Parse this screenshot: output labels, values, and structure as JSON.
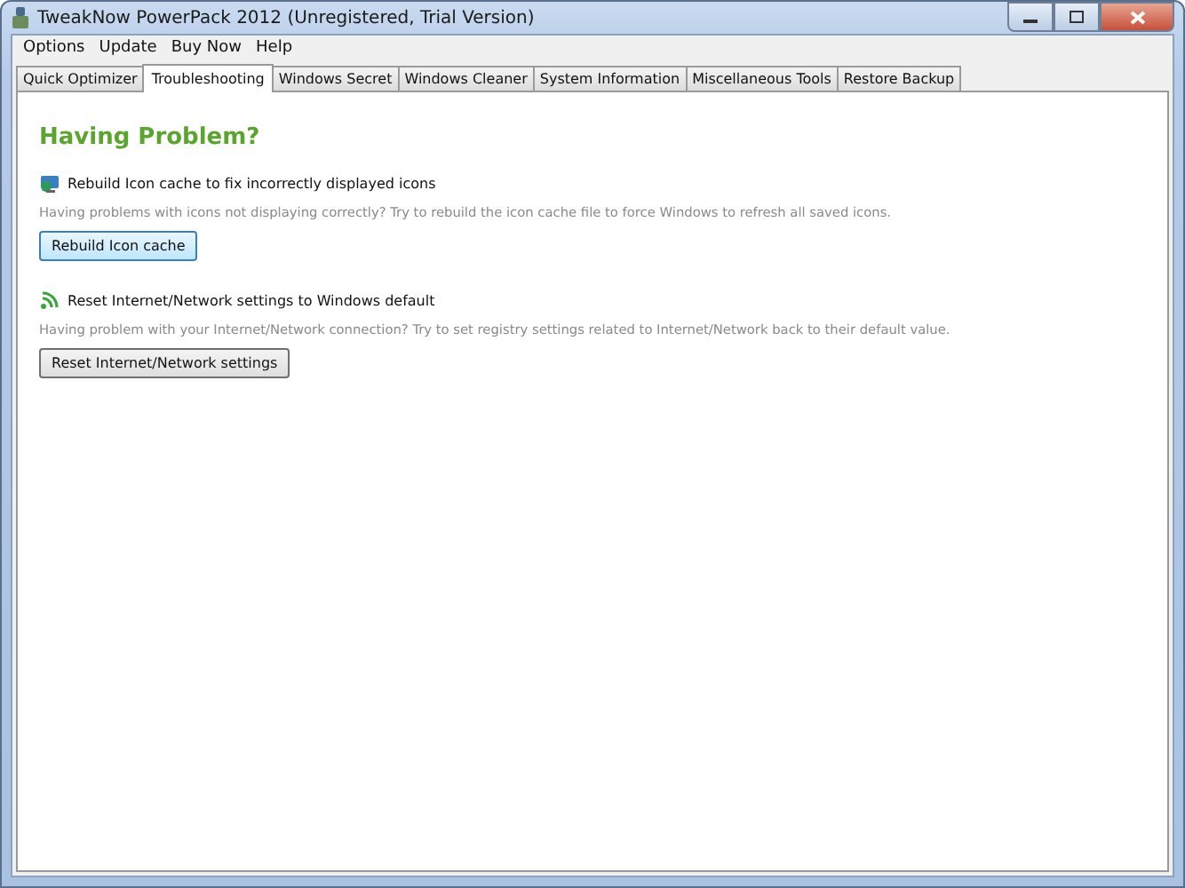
{
  "window": {
    "title": "TweakNow PowerPack 2012 (Unregistered, Trial Version)"
  },
  "menu": [
    "Options",
    "Update",
    "Buy Now",
    "Help"
  ],
  "tabs": [
    {
      "label": "Quick Optimizer",
      "selected": false
    },
    {
      "label": "Troubleshooting",
      "selected": true
    },
    {
      "label": "Windows Secret",
      "selected": false
    },
    {
      "label": "Windows Cleaner",
      "selected": false
    },
    {
      "label": "System Information",
      "selected": false
    },
    {
      "label": "Miscellaneous Tools",
      "selected": false
    },
    {
      "label": "Restore Backup",
      "selected": false
    }
  ],
  "heading": "Having Problem?",
  "sections": [
    {
      "kind": "icons",
      "title": "Rebuild Icon cache to fix incorrectly displayed icons",
      "description": "Having problems with icons not displaying correctly? Try to rebuild the icon cache file to force Windows to refresh all saved icons.",
      "button": "Rebuild Icon cache",
      "focused": true
    },
    {
      "kind": "network",
      "title": "Reset Internet/Network settings to Windows default",
      "description": "Having problem with your Internet/Network connection? Try to set registry settings related to Internet/Network back to their default value.",
      "button": "Reset Internet/Network settings",
      "focused": false
    }
  ]
}
